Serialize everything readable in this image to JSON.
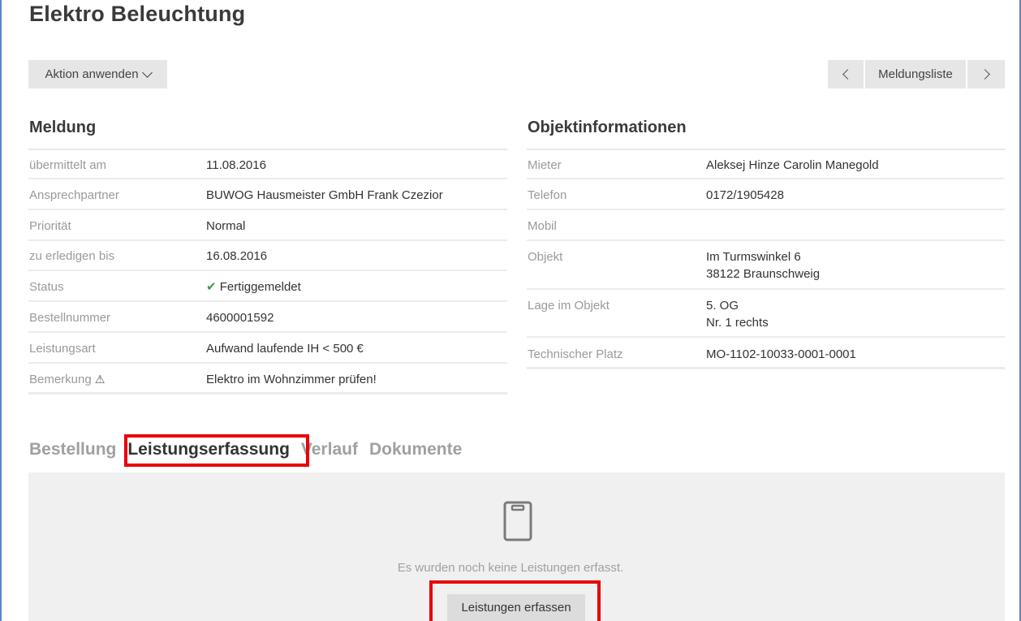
{
  "header": {
    "title": "Elektro Beleuchtung"
  },
  "toolbar": {
    "action_label": "Aktion anwenden",
    "list_label": "Meldungsliste"
  },
  "meldung": {
    "heading": "Meldung",
    "rows": [
      {
        "label": "übermittelt am",
        "value": "11.08.2016"
      },
      {
        "label": "Ansprechpartner",
        "value": "BUWOG Hausmeister GmbH Frank Czezior"
      },
      {
        "label": "Priorität",
        "value": "Normal"
      },
      {
        "label": "zu erledigen bis",
        "value": "16.08.2016"
      },
      {
        "label": "Status",
        "value": "Fertiggemeldet",
        "status_color": "#3d9a43"
      },
      {
        "label": "Bestellnummer",
        "value": "4600001592"
      },
      {
        "label": "Leistungsart",
        "value": "Aufwand laufende IH < 500 €"
      },
      {
        "label": "Bemerkung",
        "value": "Elektro im Wohnzimmer prüfen!",
        "icon": "warning-icon"
      }
    ]
  },
  "objekt": {
    "heading": "Objektinformationen",
    "rows": [
      {
        "label": "Mieter",
        "value": "Aleksej Hinze Carolin Manegold"
      },
      {
        "label": "Telefon",
        "value": "0172/1905428"
      },
      {
        "label": "Mobil",
        "value": ""
      },
      {
        "label": "Objekt",
        "line1": "Im Turmswinkel 6",
        "line2": "38122 Braunschweig"
      },
      {
        "label": "Lage im Objekt",
        "line1": "5. OG",
        "line2": "Nr. 1 rechts"
      },
      {
        "label": "Technischer Platz",
        "value": "MO-1102-10033-0001-0001"
      }
    ]
  },
  "tabs": [
    {
      "label": "Bestellung"
    },
    {
      "label": "Leistungserfassung",
      "active": true
    },
    {
      "label": "Verlauf"
    },
    {
      "label": "Dokumente"
    }
  ],
  "panel": {
    "icon": "clipboard-icon",
    "empty_message": "Es wurden noch keine Leistungen erfasst.",
    "button_label": "Leistungen erfassen"
  },
  "colors": {
    "highlight": "#e8000b",
    "panel_bg": "#f0f0f0",
    "status_ok": "#3d9a43",
    "window_frame": "#5b87c7"
  }
}
